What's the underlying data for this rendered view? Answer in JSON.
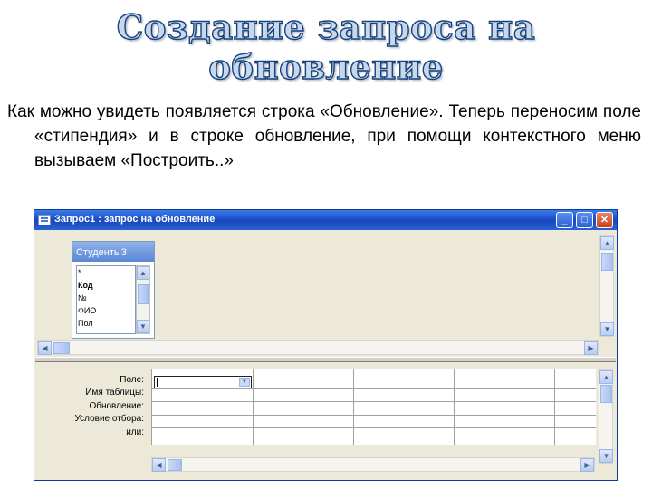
{
  "slide": {
    "title": "Создание запроса на обновление",
    "text": "Как можно увидеть появляется строка «Обновление». Теперь переносим поле «стипендия» и в строке обновление, при помощи контекстного меню вызываем «Построить..»"
  },
  "window": {
    "title": "Запрос1 : запрос на обновление",
    "buttons": {
      "minimize": "_",
      "maximize": "□",
      "close": "✕"
    }
  },
  "table": {
    "name": "Студенты3",
    "fields": [
      "*",
      "Код",
      "№",
      "ФИО",
      "Пол"
    ]
  },
  "grid": {
    "row_labels": [
      "Поле:",
      "Имя таблицы:",
      "Обновление:",
      "Условие отбора:",
      "или:"
    ]
  },
  "icons": {
    "scroll_up": "▲",
    "scroll_down": "▼",
    "scroll_left": "◀",
    "scroll_right": "▶",
    "dropdown": "▼"
  }
}
